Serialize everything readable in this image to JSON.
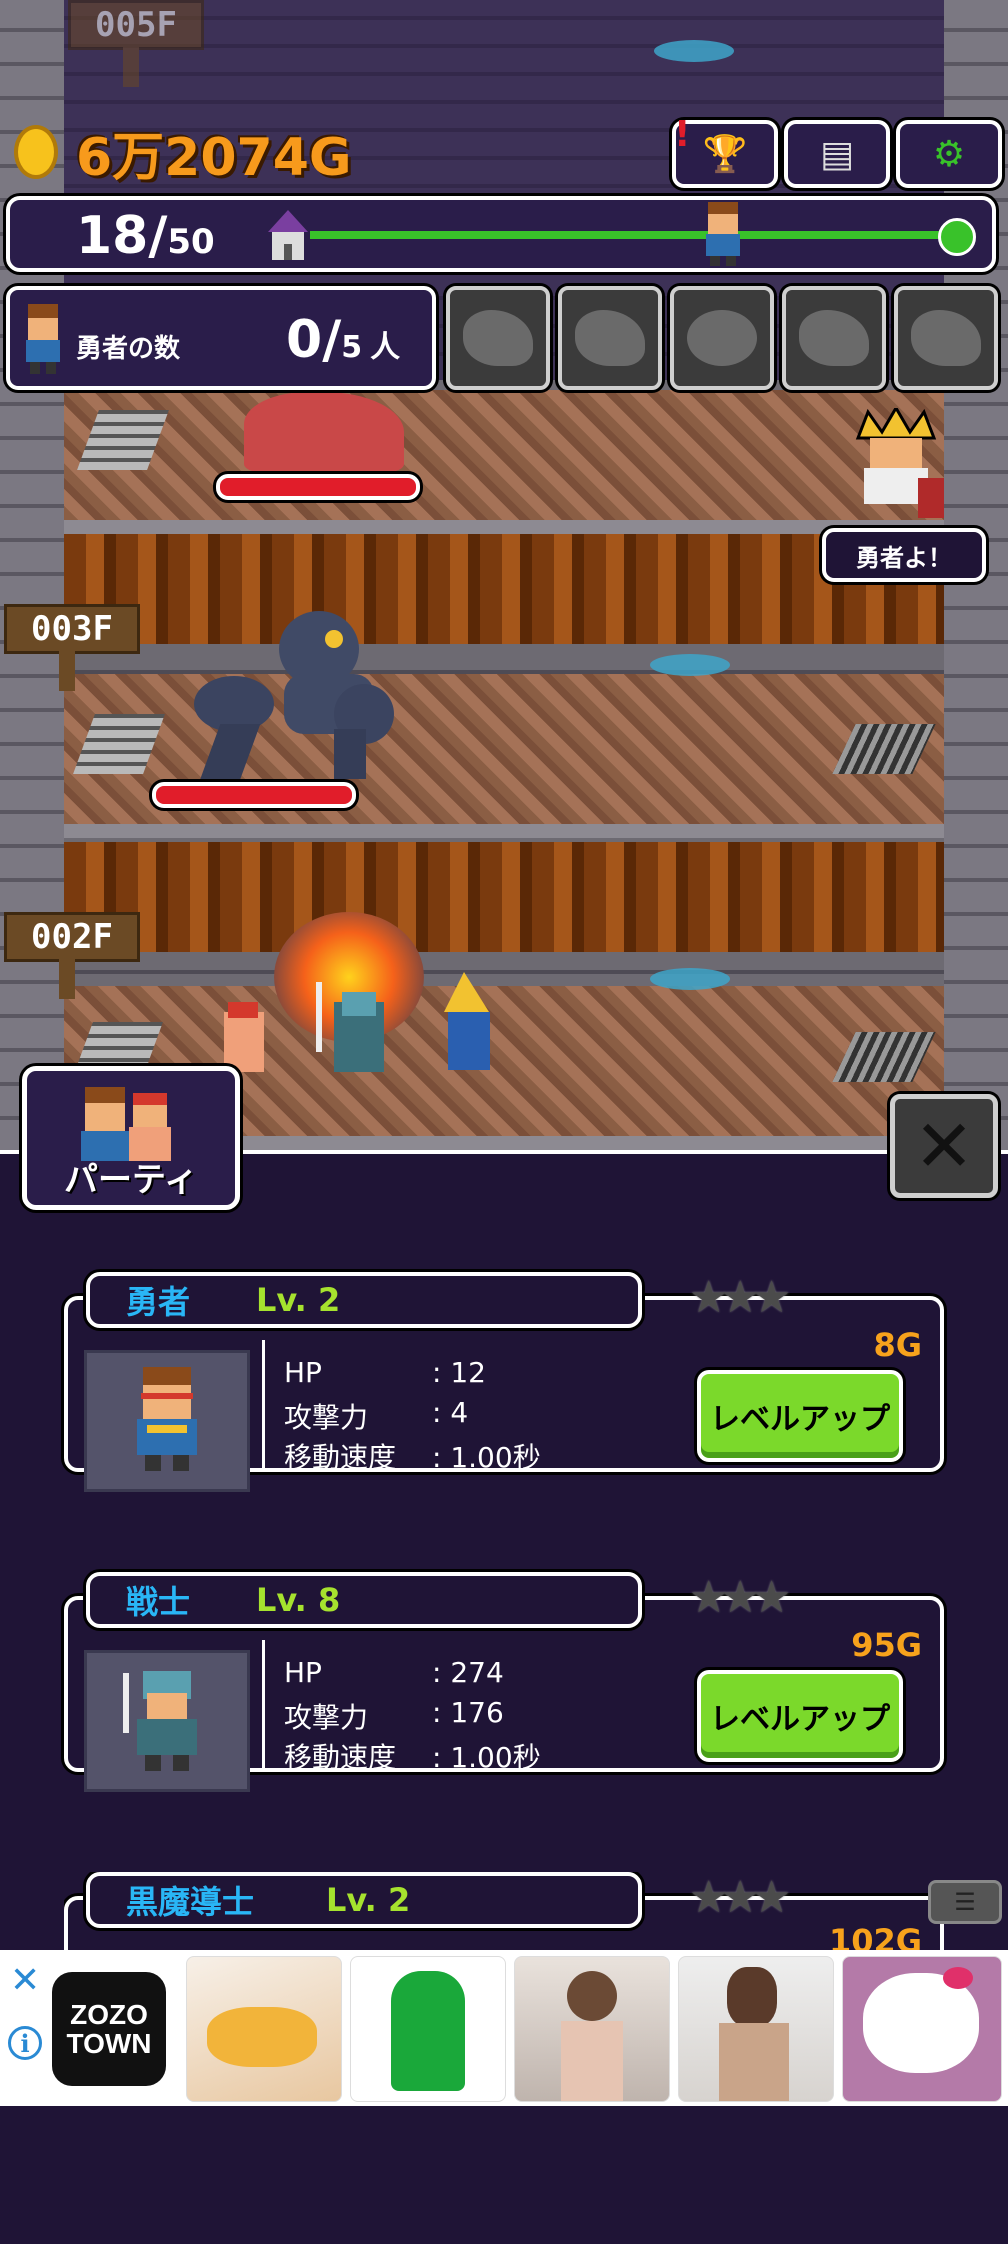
{
  "hud": {
    "gold": "6万2074G",
    "top_floor_label": "005F"
  },
  "progress": {
    "current": "18",
    "slash": "/",
    "total": "50"
  },
  "heroes": {
    "label": "勇者の数",
    "count": "0",
    "slash": "/",
    "max": "5",
    "unit": "人"
  },
  "floors": [
    {
      "label": "003F"
    },
    {
      "label": "002F"
    }
  ],
  "speech": "勇者よ！",
  "party_tab": "パーティ",
  "close_icon": "✕",
  "cards": [
    {
      "name": "勇者",
      "level": "Lv. 2",
      "cost": "8G",
      "hp_label": "HP",
      "hp": "12",
      "atk_label": "攻撃力",
      "atk": "4",
      "spd_label": "移動速度",
      "spd": "1.00秒",
      "button": "レベルアップ"
    },
    {
      "name": "戦士",
      "level": "Lv. 8",
      "cost": "95G",
      "hp_label": "HP",
      "hp": "274",
      "atk_label": "攻撃力",
      "atk": "176",
      "spd_label": "移動速度",
      "spd": "1.00秒",
      "button": "レベルアップ"
    },
    {
      "name": "黒魔導士",
      "level": "Lv. 2",
      "cost": "102G"
    }
  ],
  "ad": {
    "close": "✕",
    "info": "i",
    "logo_line1": "ZOZO",
    "logo_line2": "TOWN"
  },
  "colors": {
    "panel_bg": "#1f1436",
    "name_blue": "#29b6f6",
    "level_green": "#a6e22e",
    "gold_orange": "#f79a1c",
    "button_green": "#7bd92b",
    "hp_red": "#e11d2a"
  }
}
